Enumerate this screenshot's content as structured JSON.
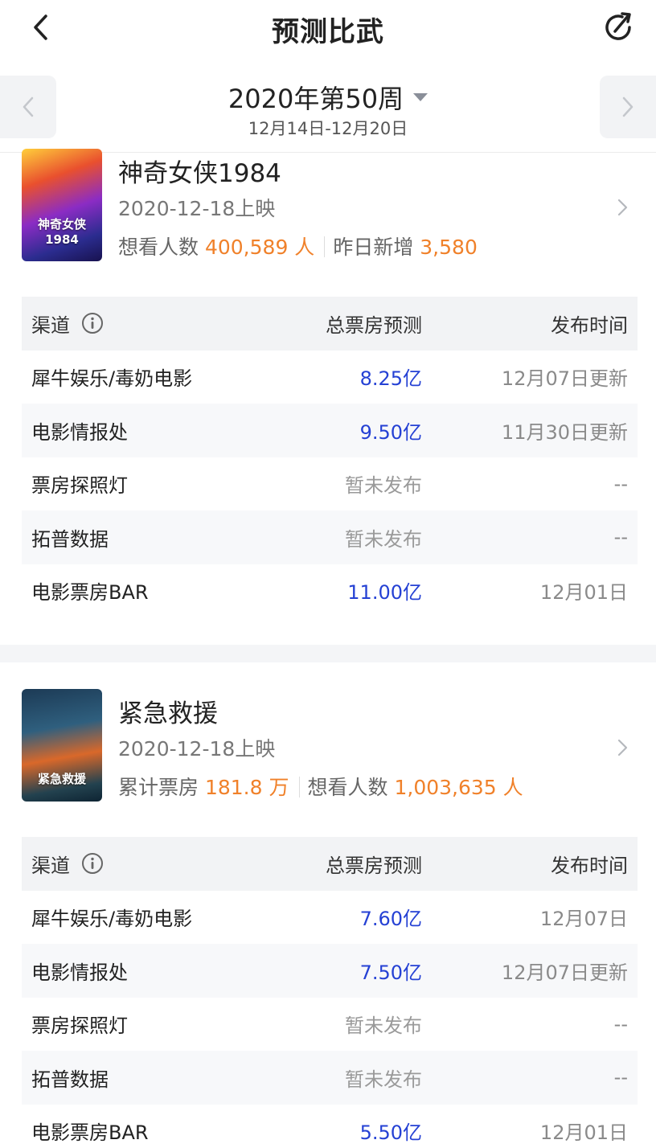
{
  "header": {
    "title": "预测比武",
    "back_icon": "chevron-left-icon",
    "share_icon": "share-icon"
  },
  "week": {
    "title": "2020年第50周",
    "range": "12月14日-12月20日"
  },
  "movies": [
    {
      "name": "神奇女侠1984",
      "release": "2020-12-18上映",
      "poster_text": "神奇女侠 1984",
      "stat1_label": "想看人数",
      "stat1_value": "400,589 人",
      "stat2_label": "昨日新增",
      "stat2_value": "3,580",
      "table": {
        "headers": {
          "channel": "渠道",
          "prediction": "总票房预测",
          "time": "发布时间"
        },
        "rows": [
          {
            "channel": "犀牛娱乐/毒奶电影",
            "prediction": "8.25亿",
            "time": "12月07日更新",
            "published": true
          },
          {
            "channel": "电影情报处",
            "prediction": "9.50亿",
            "time": "11月30日更新",
            "published": true
          },
          {
            "channel": "票房探照灯",
            "prediction": "暂未发布",
            "time": "--",
            "published": false
          },
          {
            "channel": "拓普数据",
            "prediction": "暂未发布",
            "time": "--",
            "published": false
          },
          {
            "channel": "电影票房BAR",
            "prediction": "11.00亿",
            "time": "12月01日",
            "published": true
          }
        ]
      }
    },
    {
      "name": "紧急救援",
      "release": "2020-12-18上映",
      "poster_text": "紧急救援",
      "stat1_label": "累计票房",
      "stat1_value": "181.8 万",
      "stat2_label": "想看人数",
      "stat2_value": "1,003,635 人",
      "table": {
        "headers": {
          "channel": "渠道",
          "prediction": "总票房预测",
          "time": "发布时间"
        },
        "rows": [
          {
            "channel": "犀牛娱乐/毒奶电影",
            "prediction": "7.60亿",
            "time": "12月07日",
            "published": true
          },
          {
            "channel": "电影情报处",
            "prediction": "7.50亿",
            "time": "12月07日更新",
            "published": true
          },
          {
            "channel": "票房探照灯",
            "prediction": "暂未发布",
            "time": "--",
            "published": false
          },
          {
            "channel": "拓普数据",
            "prediction": "暂未发布",
            "time": "--",
            "published": false
          },
          {
            "channel": "电影票房BAR",
            "prediction": "5.50亿",
            "time": "12月01日",
            "published": true
          }
        ]
      }
    }
  ],
  "colors": {
    "accent_orange": "#f0812a",
    "prediction_blue": "#2541d4"
  }
}
